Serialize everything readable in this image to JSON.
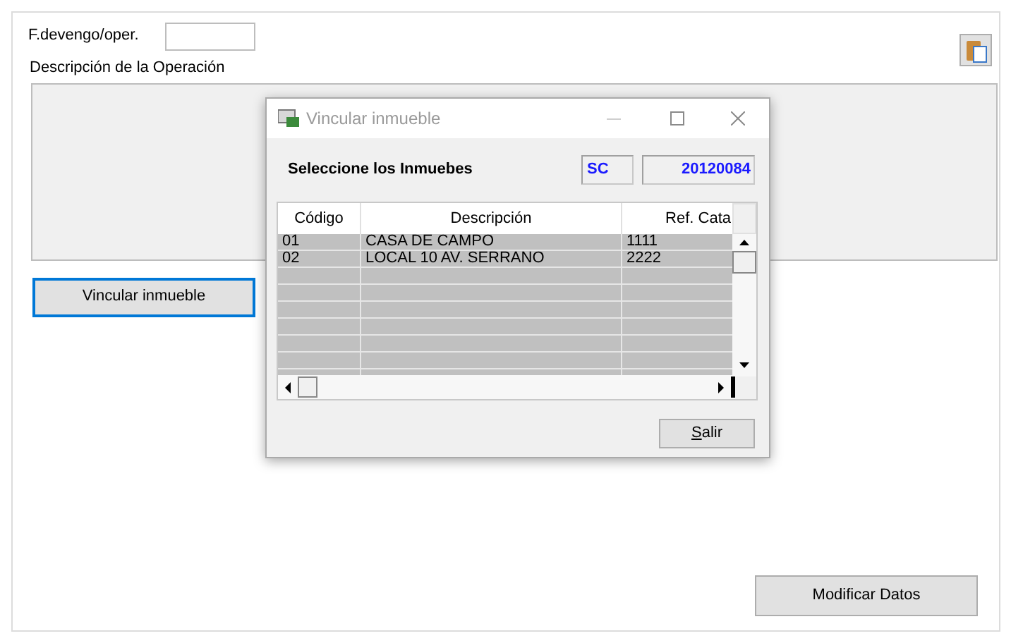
{
  "form": {
    "date_label": "F.devengo/oper.",
    "description_label": "Descripción de la Operación",
    "link_button": "Vincular inmueble",
    "modify_button": "Modificar Datos"
  },
  "dialog": {
    "title": "Vincular inmueble",
    "prompt": "Seleccione los Inmuebes",
    "code": "SC",
    "number": "20120084",
    "table": {
      "columns": [
        "Código",
        "Descripción",
        "Ref. Cata"
      ],
      "rows": [
        [
          "01",
          "CASA DE CAMPO",
          "1111"
        ],
        [
          "02",
          "LOCAL 10 AV. SERRANO",
          "2222"
        ]
      ]
    },
    "exit_button": "Salir"
  }
}
